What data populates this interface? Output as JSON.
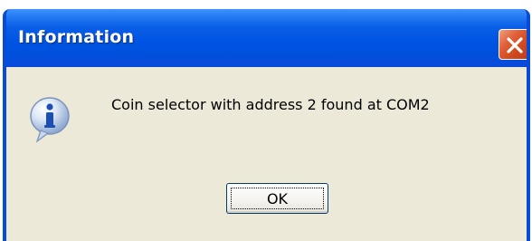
{
  "window": {
    "title": "Information",
    "close_icon": "close-icon"
  },
  "message": {
    "icon": "info-icon",
    "text": "Coin selector with address 2 found at  COM2"
  },
  "buttons": {
    "ok_label": "OK"
  },
  "colors": {
    "titlebar_blue": "#0054e3",
    "dialog_face": "#ece9d8",
    "close_red": "#d04a20"
  }
}
